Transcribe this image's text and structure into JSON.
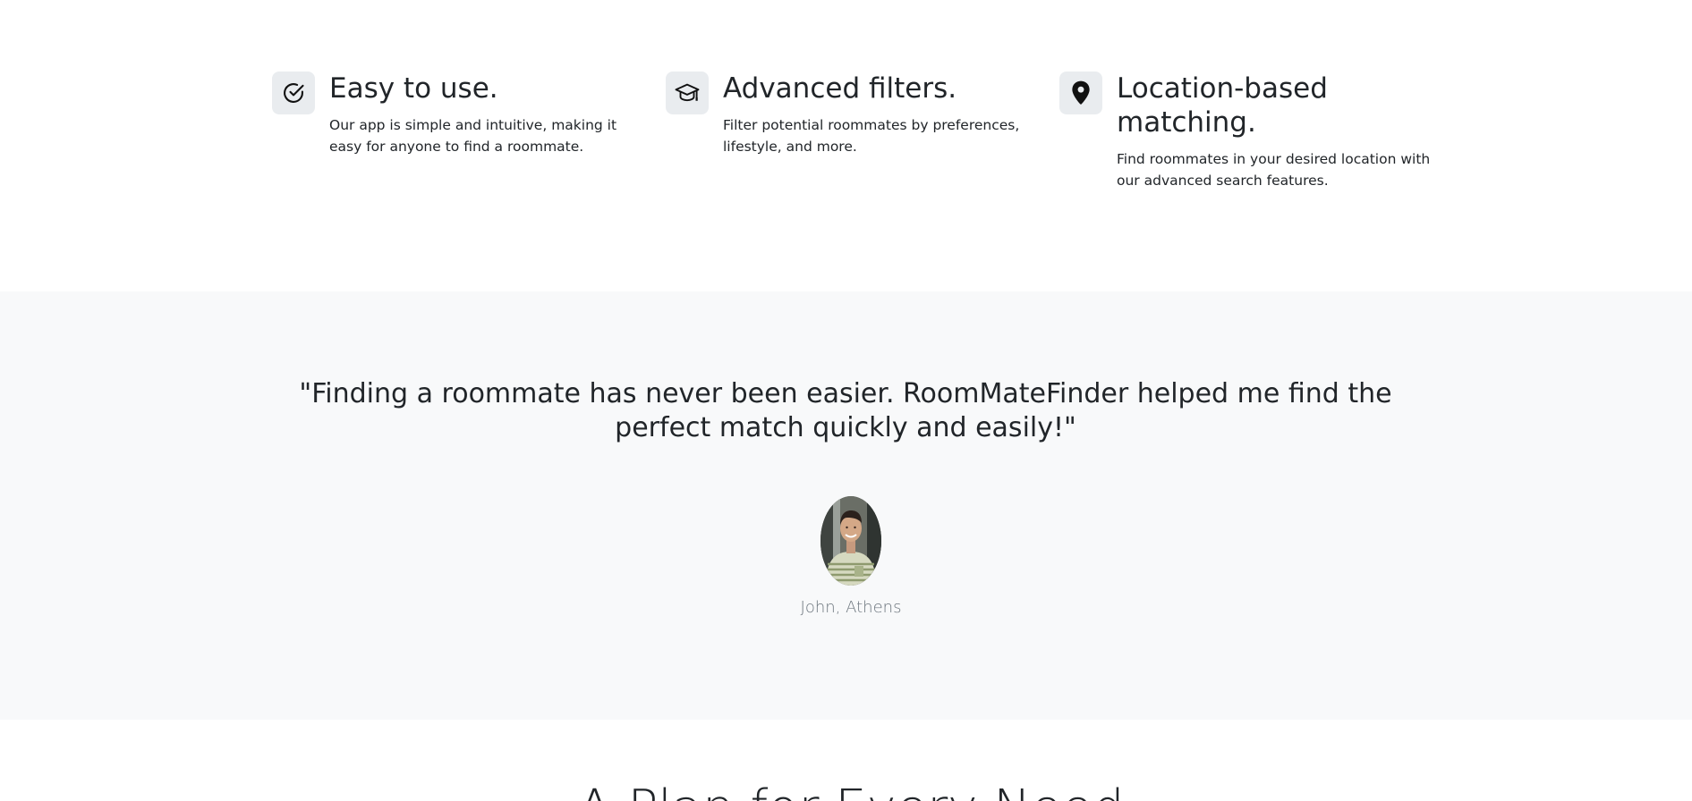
{
  "features": [
    {
      "icon": "check-circle-icon",
      "title": "Easy to use.",
      "text": "Our app is simple and intuitive, making it easy for anyone to find a roommate."
    },
    {
      "icon": "graduation-cap-icon",
      "title": "Advanced filters.",
      "text": "Filter potential roommates by preferences, lifestyle, and more."
    },
    {
      "icon": "map-pin-icon",
      "title": "Location-based matching.",
      "text": "Find roommates in your desired location with our advanced search features."
    }
  ],
  "testimonial": {
    "quote": "\"Finding a roommate has never been easier. RoomMateFinder helped me find the perfect match quickly and easily!\"",
    "author": "John, Athens",
    "avatar": "avatar-photo"
  },
  "next_section": {
    "heading": "A Plan for Every Need"
  },
  "colors": {
    "section_background": "#f8f9fa",
    "icon_background": "#e9ecef",
    "text": "#212529",
    "muted": "#6c757d"
  }
}
